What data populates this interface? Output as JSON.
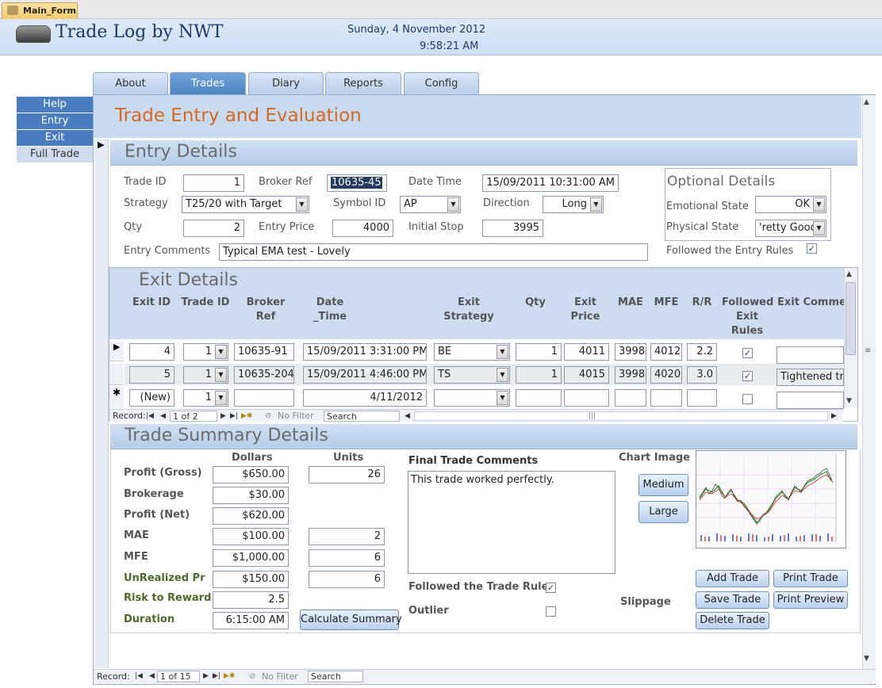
{
  "window": {
    "doc_tab": "Main_Form"
  },
  "header": {
    "title": "Trade Log by NWT",
    "date": "Sunday, 4 November 2012",
    "time": "9:58:21 AM"
  },
  "tabs": [
    "About",
    "Trades",
    "Diary",
    "Reports",
    "Config"
  ],
  "active_tab": "Trades",
  "sidenav": [
    "Help",
    "Entry",
    "Exit",
    "Full Trade"
  ],
  "form_title": "Trade Entry and Evaluation",
  "entry": {
    "section_title": "Entry Details",
    "trade_id_label": "Trade ID",
    "trade_id": "1",
    "broker_ref_label": "Broker Ref",
    "broker_ref": "10635-45",
    "datetime_label": "Date Time",
    "datetime": "15/09/2011 10:31:00 AM",
    "strategy_label": "Strategy",
    "strategy": "T25/20 with Target",
    "symbol_label": "Symbol ID",
    "symbol": "AP",
    "direction_label": "Direction",
    "direction": "Long",
    "qty_label": "Qty",
    "qty": "2",
    "entry_price_label": "Entry Price",
    "entry_price": "4000",
    "initial_stop_label": "Initial Stop",
    "initial_stop": "3995",
    "comments_label": "Entry Comments",
    "comments": "Typical EMA test - Lovely",
    "optional_title": "Optional Details",
    "emotional_label": "Emotional State",
    "emotional": "OK",
    "physical_label": "Physical State",
    "physical": "'retty Good",
    "followed_label": "Followed the Entry Rules",
    "followed": true
  },
  "exit": {
    "section_title": "Exit Details",
    "columns": [
      "Exit ID",
      "Trade ID",
      "Broker Ref",
      "Date _Time",
      "Exit Strategy",
      "Qty",
      "Exit Price",
      "MAE",
      "MFE",
      "R/R",
      "Followed Exit Rules",
      "Exit Comment"
    ],
    "rows": [
      {
        "exit_id": "4",
        "trade_id": "1",
        "broker_ref": "10635-91",
        "datetime": "15/09/2011 3:31:00 PM",
        "strategy": "BE",
        "qty": "1",
        "price": "4011",
        "mae": "3998",
        "mfe": "4012",
        "rr": "2.2",
        "followed": true,
        "comment": ""
      },
      {
        "exit_id": "5",
        "trade_id": "1",
        "broker_ref": "10635-204",
        "datetime": "15/09/2011 4:46:00 PM",
        "strategy": "TS",
        "qty": "1",
        "price": "4015",
        "mae": "3998",
        "mfe": "4020",
        "rr": "3.0",
        "followed": true,
        "comment": "Tightened tra"
      }
    ],
    "new_row": {
      "exit_id": "(New)",
      "trade_id": "1",
      "datetime": "4/11/2012"
    },
    "nav": {
      "record_label": "Record:",
      "position": "1 of 2",
      "filter": "No Filter",
      "search": "Search"
    }
  },
  "summary": {
    "section_title": "Trade Summary Details",
    "dollars_header": "Dollars",
    "units_header": "Units",
    "profit_gross_label": "Profit (Gross)",
    "profit_gross": "$650.00",
    "profit_gross_units": "26",
    "brokerage_label": "Brokerage",
    "brokerage": "$30.00",
    "profit_net_label": "Profit (Net)",
    "profit_net": "$620.00",
    "mae_label": "MAE",
    "mae": "$100.00",
    "mae_units": "2",
    "mfe_label": "MFE",
    "mfe": "$1,000.00",
    "mfe_units": "6",
    "unrealized_label": "UnRealized Pr",
    "unrealized": "$150.00",
    "unrealized_units": "6",
    "rr_label": "Risk to Reward",
    "rr": "2.5",
    "duration_label": "Duration",
    "duration": "6:15:00 AM",
    "calc_button": "Calculate Summary",
    "final_comments_label": "Final Trade Comments",
    "final_comments": "This trade worked perfectly.",
    "followed_label": "Followed the Trade Rules",
    "followed": true,
    "outlier_label": "Outlier",
    "outlier": false,
    "chart_image_label": "Chart Image",
    "medium_button": "Medium",
    "large_button": "Large",
    "slippage_label": "Slippage",
    "add_button": "Add Trade",
    "print_button": "Print Trade",
    "save_button": "Save Trade",
    "preview_button": "Print Preview",
    "delete_button": "Delete Trade"
  },
  "form_nav": {
    "record_label": "Record:",
    "position": "1 of 15",
    "filter": "No Filter",
    "search": "Search"
  },
  "glyphs": {
    "check": "✓",
    "dropdown": "▼",
    "first": "|◀",
    "prev": "◀",
    "next": "▶",
    "last": "▶|",
    "new": "▶✱",
    "record_pointer": "▶",
    "new_row_marker": "✱"
  }
}
